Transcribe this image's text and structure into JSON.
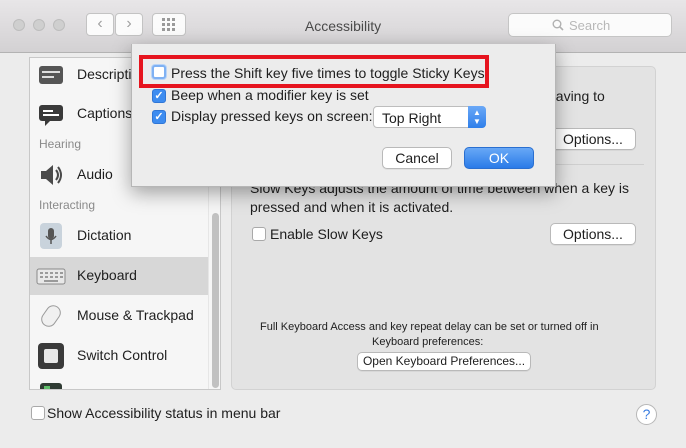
{
  "window": {
    "title": "Accessibility",
    "search_placeholder": "Search",
    "back_glyph": "‹",
    "forward_glyph": "›"
  },
  "sidebar": {
    "items": [
      {
        "label": "Descriptions",
        "icon": "descriptions-icon"
      },
      {
        "label": "Captions",
        "icon": "captions-icon"
      },
      {
        "label": "Audio",
        "icon": "speaker-icon"
      },
      {
        "label": "Dictation",
        "icon": "microphone-icon"
      },
      {
        "label": "Keyboard",
        "icon": "keyboard-icon",
        "selected": true
      },
      {
        "label": "Mouse & Trackpad",
        "icon": "mouse-icon"
      },
      {
        "label": "Switch Control",
        "icon": "switch-control-icon"
      }
    ],
    "section_hearing": "Hearing",
    "section_interacting": "Interacting"
  },
  "pane": {
    "sticky_tail": "having to",
    "options_label": "Options...",
    "slow_keys_line1": "Slow Keys adjusts the amount of time between when a key is",
    "slow_keys_line2": "pressed and when it is activated.",
    "enable_slow_keys": "Enable Slow Keys",
    "slow_keys_checked": false,
    "fka_line1": "Full Keyboard Access and key repeat delay can be set or turned off in",
    "fka_line2": "Keyboard preferences:",
    "open_keyboard_prefs": "Open Keyboard Preferences..."
  },
  "sheet": {
    "shift_toggle": "Press the Shift key five times to toggle Sticky Keys",
    "shift_toggle_checked": false,
    "beep": "Beep when a modifier key is set",
    "beep_checked": true,
    "display_keys": "Display pressed keys on screen:",
    "display_keys_checked": true,
    "position_value": "Top Right",
    "cancel_label": "Cancel",
    "ok_label": "OK",
    "checkmark": "✓",
    "highlight_color": "#e6141e"
  },
  "footer": {
    "status_label": "Show Accessibility status in menu bar",
    "status_checked": false,
    "help_label": "?"
  },
  "colors": {
    "accent": "#3d8cf0",
    "selected_row": "#d7d7d7"
  }
}
